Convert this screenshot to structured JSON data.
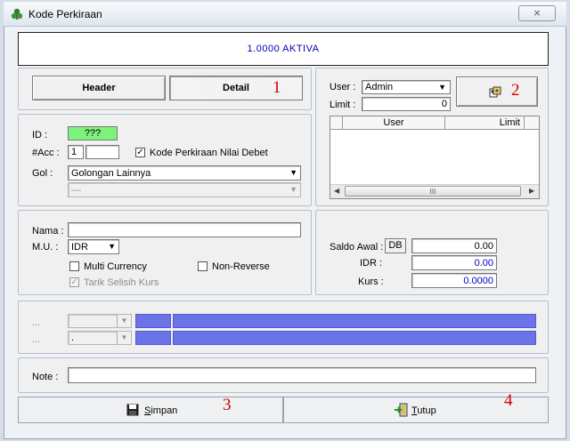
{
  "window": {
    "title": "Kode Perkiraan",
    "close_glyph": "⨯"
  },
  "header_banner": "1.0000  AKTIVA",
  "tabs": {
    "header_label": "Header",
    "detail_label": "Detail"
  },
  "annotations": {
    "n1": "1",
    "n2": "2",
    "n3": "3",
    "n4": "4"
  },
  "access": {
    "user_label": "User :",
    "user_value": "Admin",
    "limit_label": "Limit :",
    "limit_value": "0",
    "columns": [
      "User",
      "Limit"
    ],
    "scroll_mid": "III"
  },
  "ident": {
    "id_label": "ID :",
    "id_value": "???",
    "acc_label": "#Acc :",
    "acc_value": "1",
    "debet_checkbox_label": "Kode Perkiraan Nilai Debet",
    "debet_checked": "✓",
    "gol_label": "Gol :",
    "gol_value": "Golongan Lainnya",
    "subgol_value": "—"
  },
  "details": {
    "nama_label": "Nama :",
    "mu_label": "M.U. :",
    "mu_value": "IDR",
    "multi_currency_label": "Multi Currency",
    "non_reverse_label": "Non-Reverse",
    "tarik_label": "Tarik Selisih Kurs",
    "tarik_checked": "✓"
  },
  "saldo": {
    "saldo_awal_label": "Saldo Awal :",
    "db_value": "DB",
    "saldo_value": "0.00",
    "idr_label": "IDR :",
    "idr_value": "0.00",
    "kurs_label": "Kurs :",
    "kurs_value": "0.0000"
  },
  "extra": {
    "row1_label": "...",
    "row2_label": "...",
    "row2_combo": "."
  },
  "note": {
    "label": "Note :"
  },
  "footer": {
    "save_label": "Simpan",
    "save_underline": "S",
    "close_label": "Tutup",
    "close_underline": "T"
  },
  "colors": {
    "id_field_bg": "#7df27d",
    "blue_bar": "#6b74e6",
    "banner_text": "#0000b0",
    "annotation_red": "#d00000"
  }
}
